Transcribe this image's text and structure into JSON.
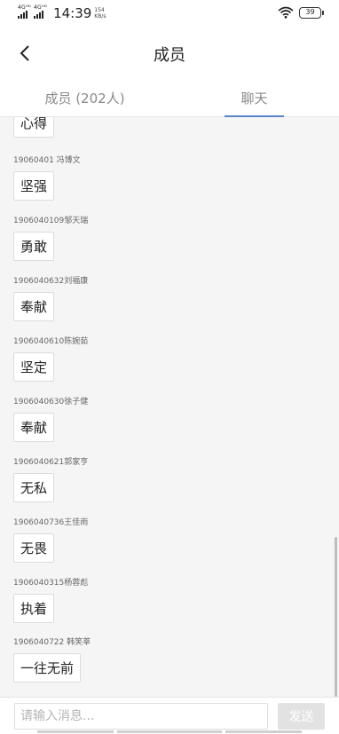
{
  "status_bar": {
    "signal1": "4Gᴴᴰ",
    "signal2": "4Gᴴᴰ",
    "time": "14:39",
    "speed_value": "154",
    "speed_unit": "KB/s",
    "battery": "39"
  },
  "header": {
    "title": "成员"
  },
  "tabs": [
    {
      "label": "成员 (202人)"
    },
    {
      "label": "聊天"
    }
  ],
  "chat": {
    "partial_top_message": "心得",
    "messages": [
      {
        "sender": "19060401 冯博文",
        "text": "坚强"
      },
      {
        "sender": "1906040109邹天瑞",
        "text": "勇敢"
      },
      {
        "sender": "1906040632刘福康",
        "text": "奉献"
      },
      {
        "sender": "1906040610陈婉茹",
        "text": "坚定"
      },
      {
        "sender": "1906040630徐子健",
        "text": "奉献"
      },
      {
        "sender": "1906040621郭家亨",
        "text": "无私"
      },
      {
        "sender": "1906040736王佳雨",
        "text": "无畏"
      },
      {
        "sender": "1906040315杨蓉彪",
        "text": "执着"
      },
      {
        "sender": "1906040722 韩笑莘",
        "text": "一往无前"
      }
    ]
  },
  "input": {
    "placeholder": "请输入消息...",
    "value": "",
    "send_label": "发送"
  }
}
